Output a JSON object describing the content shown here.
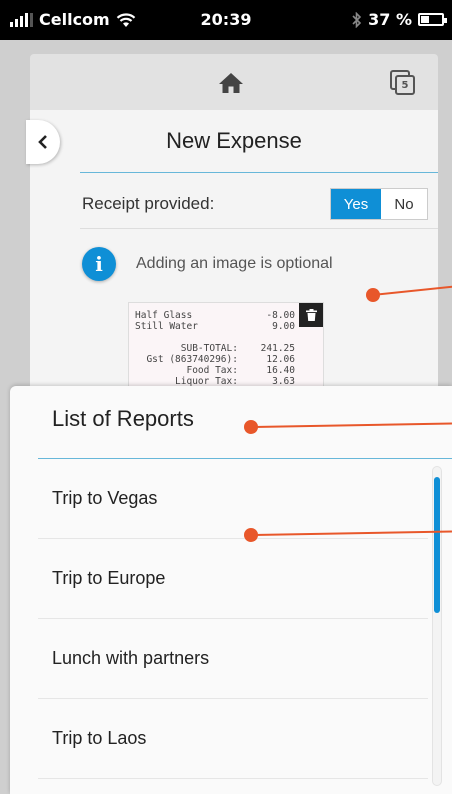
{
  "status_bar": {
    "carrier": "Cellcom",
    "time": "20:39",
    "battery": "37 %",
    "battery_level": 0.37
  },
  "top_bar": {
    "report_badge": "5"
  },
  "page": {
    "title": "New Expense",
    "receipt_label": "Receipt provided:",
    "toggle_yes": "Yes",
    "toggle_no": "No",
    "info_text": "Adding an image is optional"
  },
  "receipt_image": {
    "lines": [
      {
        "left": "Half Glass",
        "right": "-8.00"
      },
      {
        "left": "Still Water",
        "right": "9.00"
      },
      {
        "left": "",
        "right": ""
      },
      {
        "left": "        SUB-TOTAL:",
        "right": "241.25"
      },
      {
        "left": "  Gst (863740296):",
        "right": "12.06"
      },
      {
        "left": "         Food Tax:",
        "right": "16.40"
      },
      {
        "left": "       Liquor Tax:",
        "right": "3.63"
      }
    ]
  },
  "sheet": {
    "title": "List of Reports",
    "items": [
      {
        "label": "Trip to Vegas"
      },
      {
        "label": "Trip to Europe"
      },
      {
        "label": "Lunch with partners"
      },
      {
        "label": "Trip to Laos"
      }
    ]
  },
  "colors": {
    "accent": "#0f8fd6",
    "callout": "#e8572a",
    "divider": "#67b7d9"
  }
}
